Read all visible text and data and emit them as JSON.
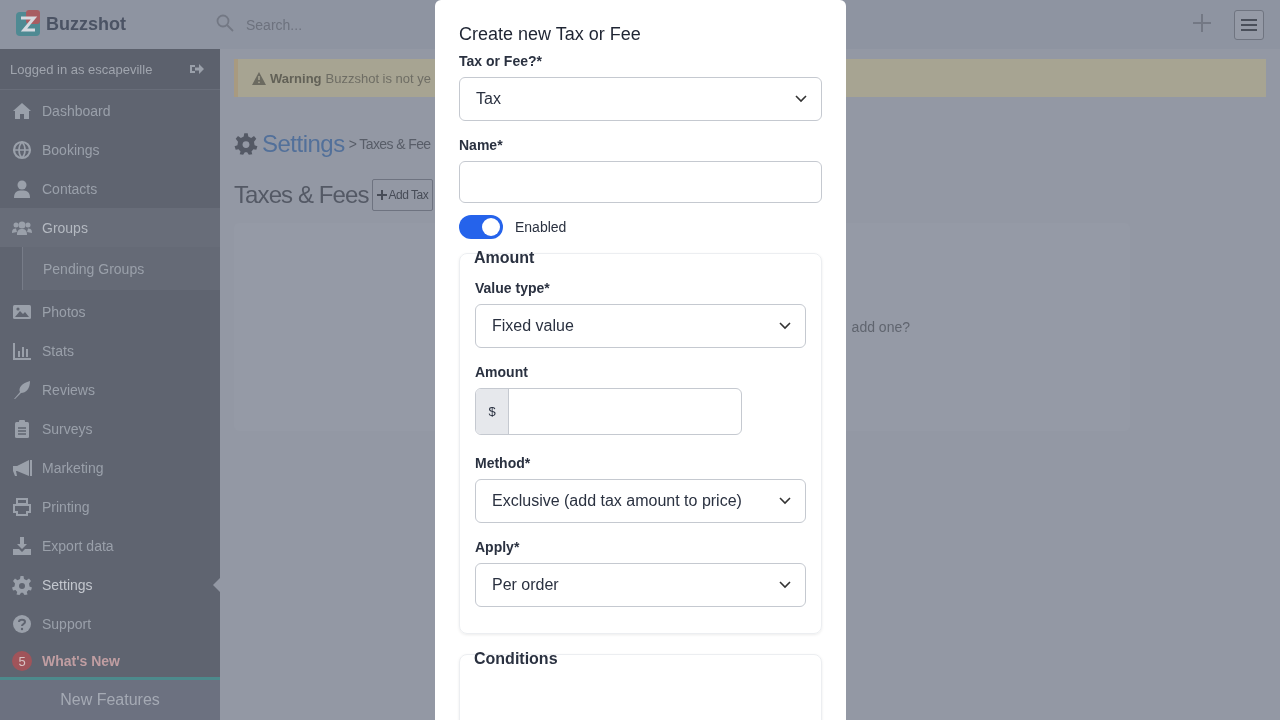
{
  "app": {
    "logo_text": "Buzzshot",
    "search": {
      "placeholder": "Search..."
    }
  },
  "sidebar": {
    "user": "Logged in as escapeville",
    "items": [
      {
        "label": "Dashboard",
        "selected": false
      },
      {
        "label": "Bookings",
        "selected": false
      },
      {
        "label": "Contacts",
        "selected": false
      },
      {
        "label": "Groups",
        "selected": false,
        "expanded": true,
        "children": [
          {
            "label": "Pending Groups",
            "selected": false
          }
        ]
      },
      {
        "label": "Photos",
        "selected": false
      },
      {
        "label": "Stats",
        "selected": false
      },
      {
        "label": "Reviews",
        "selected": false
      },
      {
        "label": "Surveys",
        "selected": false
      },
      {
        "label": "Marketing",
        "selected": false
      },
      {
        "label": "Printing",
        "selected": false
      },
      {
        "label": "Export data",
        "selected": false
      },
      {
        "label": "Settings",
        "selected": true
      },
      {
        "label": "Support",
        "selected": false
      }
    ],
    "whats_new": {
      "badge": "5",
      "label": "What's New"
    },
    "footer": "New Features"
  },
  "main": {
    "warning": {
      "title": "Warning",
      "text": "Buzzshot is not ye"
    },
    "breadcrumb": {
      "section": "Settings",
      "page": "> Taxes & Fee"
    },
    "heading": "Taxes & Fees",
    "add_button": "Add Tax",
    "empty_text": "add one?"
  },
  "modal": {
    "title": "Create new Tax or Fee",
    "fields": [
      {
        "kind": "select",
        "label": "Tax or Fee?*",
        "value": "Tax"
      },
      {
        "kind": "text",
        "label": "Name*"
      },
      {
        "kind": "toggle",
        "label": "Enabled",
        "on": true
      },
      {
        "kind": "group",
        "legend": "Amount",
        "fields": [
          {
            "kind": "select",
            "label": "Value type*",
            "value": "Fixed value"
          },
          {
            "kind": "currency",
            "label": "Amount",
            "prefix": "$"
          },
          {
            "kind": "select",
            "label": "Method*",
            "value": "Exclusive (add tax amount to price)"
          },
          {
            "kind": "select",
            "label": "Apply*",
            "value": "Per order"
          }
        ]
      },
      {
        "kind": "group",
        "legend": "Conditions"
      }
    ]
  }
}
